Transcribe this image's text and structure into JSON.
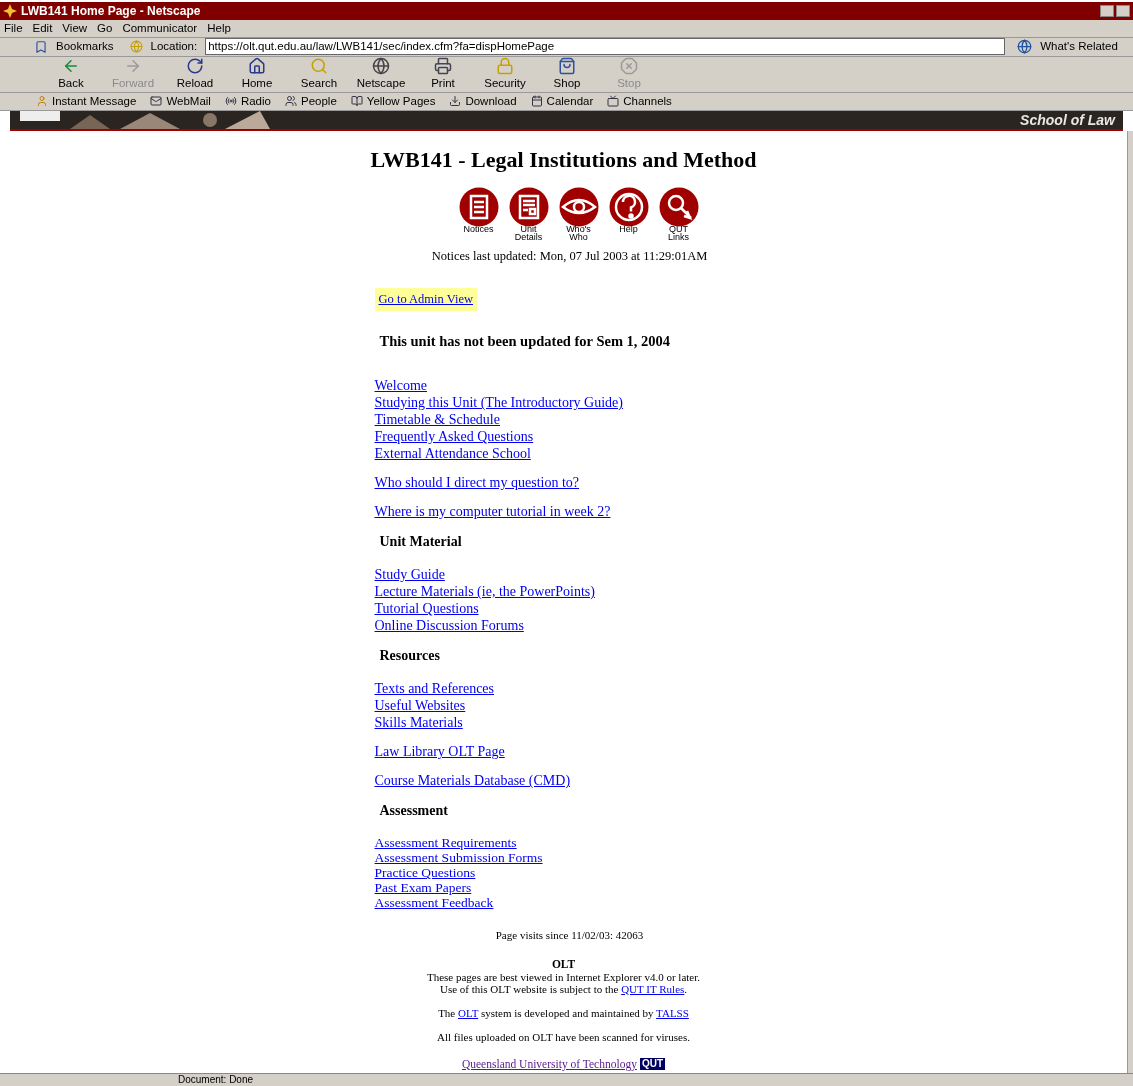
{
  "window": {
    "title": "LWB141 Home Page - Netscape"
  },
  "menu": [
    "File",
    "Edit",
    "View",
    "Go",
    "Communicator",
    "Help"
  ],
  "location": {
    "bookmarks": "Bookmarks",
    "label": "Location:",
    "url": "https://olt.qut.edu.au/law/LWB141/sec/index.cfm?fa=dispHomePage",
    "related": "What's Related"
  },
  "toolbar": [
    {
      "label": "Back",
      "disabled": false
    },
    {
      "label": "Forward",
      "disabled": true
    },
    {
      "label": "Reload",
      "disabled": false
    },
    {
      "label": "Home",
      "disabled": false
    },
    {
      "label": "Search",
      "disabled": false
    },
    {
      "label": "Netscape",
      "disabled": false
    },
    {
      "label": "Print",
      "disabled": false
    },
    {
      "label": "Security",
      "disabled": false
    },
    {
      "label": "Shop",
      "disabled": false
    },
    {
      "label": "Stop",
      "disabled": true
    }
  ],
  "personal_toolbar": [
    "Instant Message",
    "WebMail",
    "Radio",
    "People",
    "Yellow Pages",
    "Download",
    "Calendar",
    "Channels"
  ],
  "banner": {
    "text": "School of Law"
  },
  "page": {
    "title": "LWB141 - Legal Institutions and Method",
    "nav_icons": [
      {
        "kind": "notices",
        "label": "Notices"
      },
      {
        "kind": "details",
        "label": "Unit Details"
      },
      {
        "kind": "eye",
        "label": "Who's Who"
      },
      {
        "kind": "help",
        "label": "Help"
      },
      {
        "kind": "links",
        "label": "QUT Links"
      }
    ],
    "updated": "Notices last updated: Mon, 07 Jul 2003 at 11:29:01AM",
    "admin_link": "Go to Admin View",
    "notice": "This unit has not been updated for Sem 1, 2004",
    "sections": [
      {
        "groups": [
          [
            "Welcome",
            "Studying this Unit (The Introductory Guide)",
            "Timetable & Schedule",
            "Frequently Asked Questions",
            "External Attendance School"
          ],
          [
            "Who should I direct my question to?"
          ],
          [
            "Where is my computer tutorial in week 2?"
          ]
        ]
      },
      {
        "heading": "Unit Material",
        "groups": [
          [
            "Study Guide",
            "Lecture Materials (ie, the PowerPoints)",
            "Tutorial Questions",
            "Online Discussion Forums"
          ]
        ]
      },
      {
        "heading": "Resources",
        "groups": [
          [
            "Texts and References",
            "Useful Websites",
            "Skills Materials"
          ],
          [
            "Law Library OLT Page"
          ],
          [
            "Course Materials Database (CMD)"
          ]
        ]
      },
      {
        "heading": "Assessment",
        "groups": [
          [
            "Assessment Requirements",
            "Assessment Submission Forms",
            "Practice Questions",
            "Past Exam Papers",
            "Assessment Feedback"
          ]
        ]
      }
    ],
    "visits": "Page visits since 11/02/03: 42063",
    "footer_title": "OLT",
    "footer_lines": [
      [
        {
          "text": "These pages are best viewed in Internet Explorer v4.0 or later."
        }
      ],
      [
        {
          "text": "Use of this OLT website is subject to the "
        },
        {
          "link": "QUT IT Rules"
        },
        {
          "text": "."
        }
      ],
      [
        {
          "text": "The "
        },
        {
          "link": "OLT"
        },
        {
          "text": " system is developed and maintained by "
        },
        {
          "link": "TALSS"
        }
      ],
      [
        {
          "text": "All files uploaded on OLT have been scanned for viruses."
        }
      ]
    ],
    "university_link": "Queensland University of Technology",
    "logo": "QUT"
  },
  "status_bar": {
    "text": "Document: Done"
  }
}
